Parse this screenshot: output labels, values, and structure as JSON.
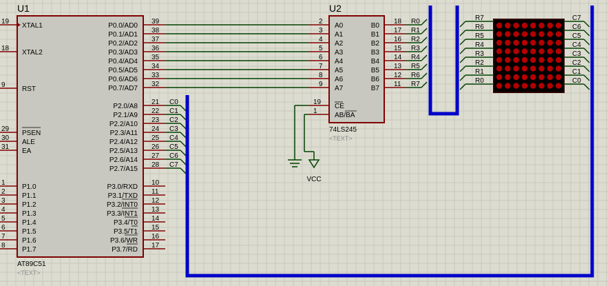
{
  "u1": {
    "ref": "U1",
    "part": "AT89C51",
    "text_tag": "<TEXT>",
    "left_pins": [
      {
        "num": "19",
        "name": "XTAL1"
      },
      {
        "num": "18",
        "name": "XTAL2"
      },
      {
        "num": "9",
        "name": "RST"
      },
      {
        "num": "29",
        "name": "PSEN"
      },
      {
        "num": "30",
        "name": "ALE"
      },
      {
        "num": "31",
        "name": "EA"
      },
      {
        "num": "1",
        "name": "P1.0"
      },
      {
        "num": "2",
        "name": "P1.1"
      },
      {
        "num": "3",
        "name": "P1.2"
      },
      {
        "num": "4",
        "name": "P1.3"
      },
      {
        "num": "5",
        "name": "P1.4"
      },
      {
        "num": "6",
        "name": "P1.5"
      },
      {
        "num": "7",
        "name": "P1.6"
      },
      {
        "num": "8",
        "name": "P1.7"
      }
    ],
    "p0_pins": [
      {
        "num": "39",
        "name": "P0.0/AD0"
      },
      {
        "num": "38",
        "name": "P0.1/AD1"
      },
      {
        "num": "37",
        "name": "P0.2/AD2"
      },
      {
        "num": "36",
        "name": "P0.3/AD3"
      },
      {
        "num": "35",
        "name": "P0.4/AD4"
      },
      {
        "num": "34",
        "name": "P0.5/AD5"
      },
      {
        "num": "33",
        "name": "P0.6/AD6"
      },
      {
        "num": "32",
        "name": "P0.7/AD7"
      }
    ],
    "p2_pins": [
      {
        "num": "21",
        "name": "P2.0/A8",
        "net": "C0"
      },
      {
        "num": "22",
        "name": "P2.1/A9",
        "net": "C1"
      },
      {
        "num": "23",
        "name": "P2.2/A10",
        "net": "C2"
      },
      {
        "num": "24",
        "name": "P2.3/A11",
        "net": "C3"
      },
      {
        "num": "25",
        "name": "P2.4/A12",
        "net": "C4"
      },
      {
        "num": "26",
        "name": "P2.5/A13",
        "net": "C5"
      },
      {
        "num": "27",
        "name": "P2.6/A14",
        "net": "C6"
      },
      {
        "num": "28",
        "name": "P2.7/A15",
        "net": "C7"
      }
    ],
    "p3_pins": [
      {
        "num": "10",
        "name": "P3.0/RXD"
      },
      {
        "num": "11",
        "name": "P3.1/TXD"
      },
      {
        "num": "12",
        "name": "P3.2/INT0"
      },
      {
        "num": "13",
        "name": "P3.3/INT1"
      },
      {
        "num": "14",
        "name": "P3.4/T0"
      },
      {
        "num": "15",
        "name": "P3.5/T1"
      },
      {
        "num": "16",
        "name": "P3.6/WR"
      },
      {
        "num": "17",
        "name": "P3.7/RD"
      }
    ]
  },
  "u2": {
    "ref": "U2",
    "part": "74LS245",
    "text_tag": "<TEXT>",
    "a_pins": [
      {
        "num": "2",
        "name": "A0"
      },
      {
        "num": "3",
        "name": "A1"
      },
      {
        "num": "4",
        "name": "A2"
      },
      {
        "num": "5",
        "name": "A3"
      },
      {
        "num": "6",
        "name": "A4"
      },
      {
        "num": "7",
        "name": "A5"
      },
      {
        "num": "8",
        "name": "A6"
      },
      {
        "num": "9",
        "name": "A7"
      }
    ],
    "b_pins": [
      {
        "num": "18",
        "name": "B0",
        "net": "R0"
      },
      {
        "num": "17",
        "name": "B1",
        "net": "R1"
      },
      {
        "num": "16",
        "name": "B2",
        "net": "R2"
      },
      {
        "num": "15",
        "name": "B3",
        "net": "R3"
      },
      {
        "num": "14",
        "name": "B4",
        "net": "R4"
      },
      {
        "num": "13",
        "name": "B5",
        "net": "R5"
      },
      {
        "num": "12",
        "name": "B6",
        "net": "R6"
      },
      {
        "num": "11",
        "name": "B7",
        "net": "R7"
      }
    ],
    "ctrl_pins": [
      {
        "num": "19",
        "name": "CE"
      },
      {
        "num": "1",
        "name": "AB/BA"
      }
    ]
  },
  "power": {
    "vcc_label": "VCC"
  },
  "matrix": {
    "rows": 8,
    "cols": 8,
    "row_labels": [
      "R7",
      "R6",
      "R5",
      "R4",
      "R3",
      "R2",
      "R1",
      "R0"
    ],
    "col_labels": [
      "C7",
      "C6",
      "C5",
      "C4",
      "C3",
      "C2",
      "C1",
      "C0"
    ]
  },
  "colors": {
    "background": "#dcdcd0",
    "grid": "#c8c8bc",
    "body_fill": "#c8c8c0",
    "outline": "#800000",
    "wire": "#004000",
    "bus": "#0000c8",
    "led_on": "#b40000",
    "led_frame": "#300000",
    "text": "#000000",
    "text_tag": "#909090"
  }
}
